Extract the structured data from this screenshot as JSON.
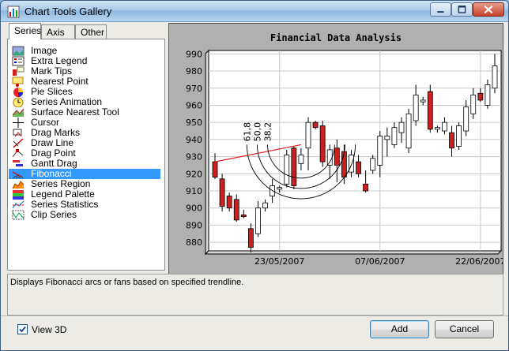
{
  "window": {
    "title": "Chart Tools Gallery"
  },
  "tabs": [
    {
      "label": "Series",
      "active": true
    },
    {
      "label": "Axis",
      "active": false
    },
    {
      "label": "Other",
      "active": false
    }
  ],
  "tools": [
    {
      "label": "Image",
      "icon": "image-icon"
    },
    {
      "label": "Extra Legend",
      "icon": "legend-icon"
    },
    {
      "label": "Mark Tips",
      "icon": "mark-tips-icon"
    },
    {
      "label": "Nearest Point",
      "icon": "nearest-point-icon"
    },
    {
      "label": "Pie Slices",
      "icon": "pie-slices-icon"
    },
    {
      "label": "Series Animation",
      "icon": "animation-clock-icon"
    },
    {
      "label": "Surface Nearest Tool",
      "icon": "surface-icon"
    },
    {
      "label": "Cursor",
      "icon": "cursor-crosshair-icon"
    },
    {
      "label": "Drag Marks",
      "icon": "drag-marks-icon"
    },
    {
      "label": "Draw Line",
      "icon": "draw-line-icon"
    },
    {
      "label": "Drag Point",
      "icon": "drag-point-icon"
    },
    {
      "label": "Gantt Drag",
      "icon": "gantt-icon"
    },
    {
      "label": "Fibonacci",
      "icon": "fibonacci-icon",
      "selected": true
    },
    {
      "label": "Series Region",
      "icon": "series-region-icon"
    },
    {
      "label": "Legend Palette",
      "icon": "legend-palette-icon"
    },
    {
      "label": "Series Statistics",
      "icon": "statistics-icon"
    },
    {
      "label": "Clip Series",
      "icon": "clip-series-icon"
    }
  ],
  "description": "Displays Fibonacci arcs or fans based on specified trendline.",
  "view3d": {
    "label": "View 3D",
    "checked": true
  },
  "buttons": {
    "add": "Add",
    "cancel": "Cancel"
  },
  "colors": {
    "selection": "#3399ff",
    "up_candle": "#ffffff",
    "down_candle": "#cc1f1f",
    "trendline": "#e02020"
  },
  "chart_data": {
    "type": "candlestick",
    "title": "Financial Data Analysis",
    "ylim": [
      875,
      992
    ],
    "yticks": [
      880,
      890,
      900,
      910,
      920,
      930,
      940,
      950,
      960,
      970,
      980,
      990
    ],
    "xtick_labels": [
      "23/05/2007",
      "07/06/2007",
      "22/06/2007"
    ],
    "grid": true,
    "fibonacci_levels": [
      "61,8",
      "50,0",
      "38,2"
    ],
    "candles": [
      {
        "o": 927,
        "h": 932,
        "l": 917,
        "c": 918
      },
      {
        "o": 917,
        "h": 920,
        "l": 898,
        "c": 901
      },
      {
        "o": 907,
        "h": 909,
        "l": 898,
        "c": 900
      },
      {
        "o": 905,
        "h": 908,
        "l": 892,
        "c": 893
      },
      {
        "o": 896,
        "h": 899,
        "l": 894,
        "c": 895
      },
      {
        "o": 888,
        "h": 891,
        "l": 874,
        "c": 877
      },
      {
        "o": 885,
        "h": 904,
        "l": 883,
        "c": 900
      },
      {
        "o": 900,
        "h": 905,
        "l": 898,
        "c": 903
      },
      {
        "o": 907,
        "h": 917,
        "l": 903,
        "c": 913
      },
      {
        "o": 911,
        "h": 913,
        "l": 909,
        "c": 912
      },
      {
        "o": 914,
        "h": 934,
        "l": 912,
        "c": 931
      },
      {
        "o": 935,
        "h": 936,
        "l": 911,
        "c": 913
      },
      {
        "o": 926,
        "h": 935,
        "l": 922,
        "c": 931
      },
      {
        "o": 935,
        "h": 953,
        "l": 922,
        "c": 950
      },
      {
        "o": 950,
        "h": 951,
        "l": 946,
        "c": 947
      },
      {
        "o": 948,
        "h": 951,
        "l": 924,
        "c": 927
      },
      {
        "o": 925,
        "h": 937,
        "l": 917,
        "c": 934
      },
      {
        "o": 935,
        "h": 940,
        "l": 915,
        "c": 925
      },
      {
        "o": 933,
        "h": 937,
        "l": 914,
        "c": 918
      },
      {
        "o": 921,
        "h": 934,
        "l": 918,
        "c": 931
      },
      {
        "o": 927,
        "h": 931,
        "l": 918,
        "c": 920
      },
      {
        "o": 914,
        "h": 922,
        "l": 909,
        "c": 910
      },
      {
        "o": 922,
        "h": 931,
        "l": 920,
        "c": 929
      },
      {
        "o": 925,
        "h": 945,
        "l": 918,
        "c": 942
      },
      {
        "o": 940,
        "h": 947,
        "l": 930,
        "c": 942
      },
      {
        "o": 937,
        "h": 950,
        "l": 935,
        "c": 947
      },
      {
        "o": 944,
        "h": 953,
        "l": 938,
        "c": 950
      },
      {
        "o": 935,
        "h": 958,
        "l": 932,
        "c": 955
      },
      {
        "o": 951,
        "h": 972,
        "l": 948,
        "c": 966
      },
      {
        "o": 962,
        "h": 965,
        "l": 960,
        "c": 963
      },
      {
        "o": 968,
        "h": 972,
        "l": 944,
        "c": 946
      },
      {
        "o": 946,
        "h": 948,
        "l": 944,
        "c": 947
      },
      {
        "o": 945,
        "h": 953,
        "l": 943,
        "c": 950
      },
      {
        "o": 944,
        "h": 948,
        "l": 930,
        "c": 935
      },
      {
        "o": 936,
        "h": 950,
        "l": 934,
        "c": 948
      },
      {
        "o": 945,
        "h": 963,
        "l": 942,
        "c": 959
      },
      {
        "o": 955,
        "h": 970,
        "l": 952,
        "c": 966
      },
      {
        "o": 967,
        "h": 970,
        "l": 962,
        "c": 963
      },
      {
        "o": 960,
        "h": 975,
        "l": 958,
        "c": 972
      },
      {
        "o": 970,
        "h": 990,
        "l": 967,
        "c": 983
      }
    ]
  }
}
